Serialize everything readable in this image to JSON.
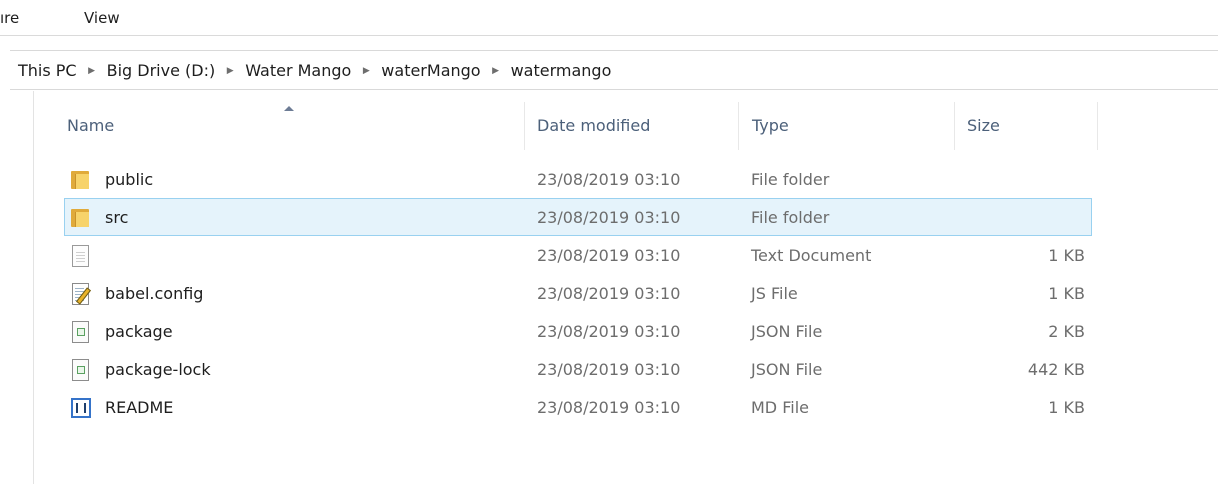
{
  "ribbon": {
    "tabs": [
      {
        "label": "ıre"
      },
      {
        "label": "View"
      }
    ]
  },
  "address_bar": {
    "crumbs": [
      "This PC",
      "Big Drive (D:)",
      "Water Mango",
      "waterMango",
      "watermango"
    ],
    "separator_icon": "chevron-right-icon"
  },
  "columns": {
    "name": "Name",
    "date_modified": "Date modified",
    "type": "Type",
    "size": "Size",
    "sorted_by": "name",
    "sort_direction": "ascending"
  },
  "files": [
    {
      "name": "public",
      "date": "23/08/2019 03:10",
      "type": "File folder",
      "size": "",
      "icon": "folder-icon",
      "selected": false
    },
    {
      "name": "src",
      "date": "23/08/2019 03:10",
      "type": "File folder",
      "size": "",
      "icon": "folder-icon",
      "selected": true
    },
    {
      "name": "",
      "date": "23/08/2019 03:10",
      "type": "Text Document",
      "size": "1 KB",
      "icon": "text-document-icon",
      "selected": false
    },
    {
      "name": "babel.config",
      "date": "23/08/2019 03:10",
      "type": "JS File",
      "size": "1 KB",
      "icon": "js-file-icon",
      "selected": false
    },
    {
      "name": "package",
      "date": "23/08/2019 03:10",
      "type": "JSON File",
      "size": "2 KB",
      "icon": "json-file-icon",
      "selected": false
    },
    {
      "name": "package-lock",
      "date": "23/08/2019 03:10",
      "type": "JSON File",
      "size": "442 KB",
      "icon": "json-file-icon",
      "selected": false
    },
    {
      "name": "README",
      "date": "23/08/2019 03:10",
      "type": "MD File",
      "size": "1 KB",
      "icon": "md-file-icon",
      "selected": false
    }
  ],
  "colors": {
    "selection_bg": "#e5f3fb",
    "selection_border": "#99d1f0",
    "header_text": "#4c607a",
    "detail_text": "#6d6d6d"
  }
}
